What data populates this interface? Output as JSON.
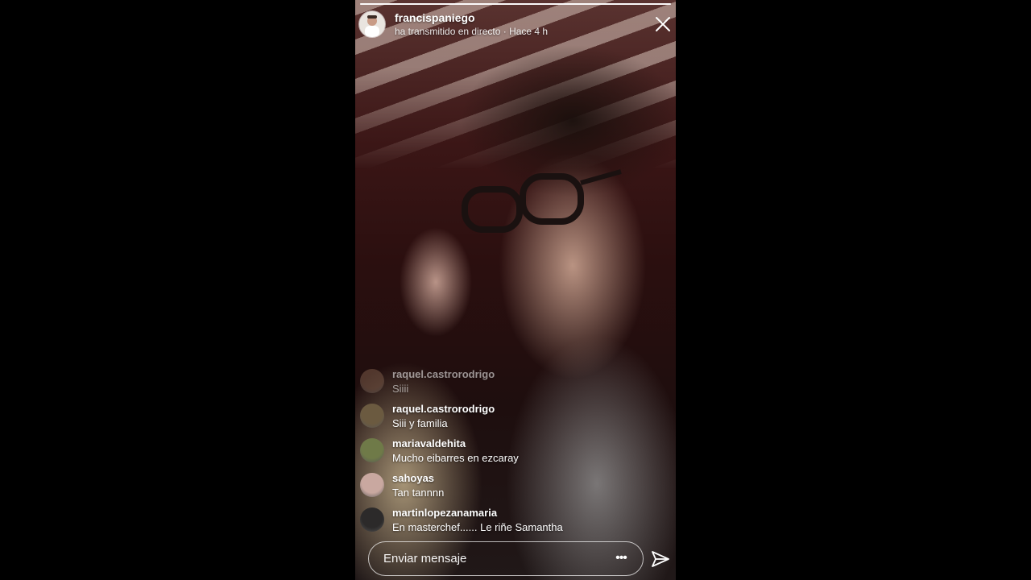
{
  "header": {
    "username": "francispaniego",
    "subtitle": "ha transmitido en directo · Hace 4 h",
    "progress": 1.0
  },
  "comments": [
    {
      "user": "raquel.castrorodrigo",
      "text": "Siiii",
      "faded": true,
      "avatar_color": "#7a5a48"
    },
    {
      "user": "raquel.castrorodrigo",
      "text": "Siii y familia",
      "faded": false,
      "avatar_color": "#6b5a40"
    },
    {
      "user": "mariavaldehita",
      "text": "Mucho eibarres en ezcaray",
      "faded": false,
      "avatar_color": "#6f7a48"
    },
    {
      "user": "sahoyas",
      "text": "Tan tannnn",
      "faded": false,
      "avatar_color": "#c9a8a0"
    },
    {
      "user": "martinlopezanamaria",
      "text": "En masterchef...... Le riñe Samantha",
      "faded": false,
      "avatar_color": "#2c2a2a"
    }
  ],
  "composer": {
    "placeholder": "Enviar mensaje",
    "more_label": "•••"
  },
  "icons": {
    "close": "close-icon",
    "send": "send-icon",
    "more": "more-options-icon"
  },
  "colors": {
    "text": "#ffffff",
    "page_background": "#000000"
  }
}
